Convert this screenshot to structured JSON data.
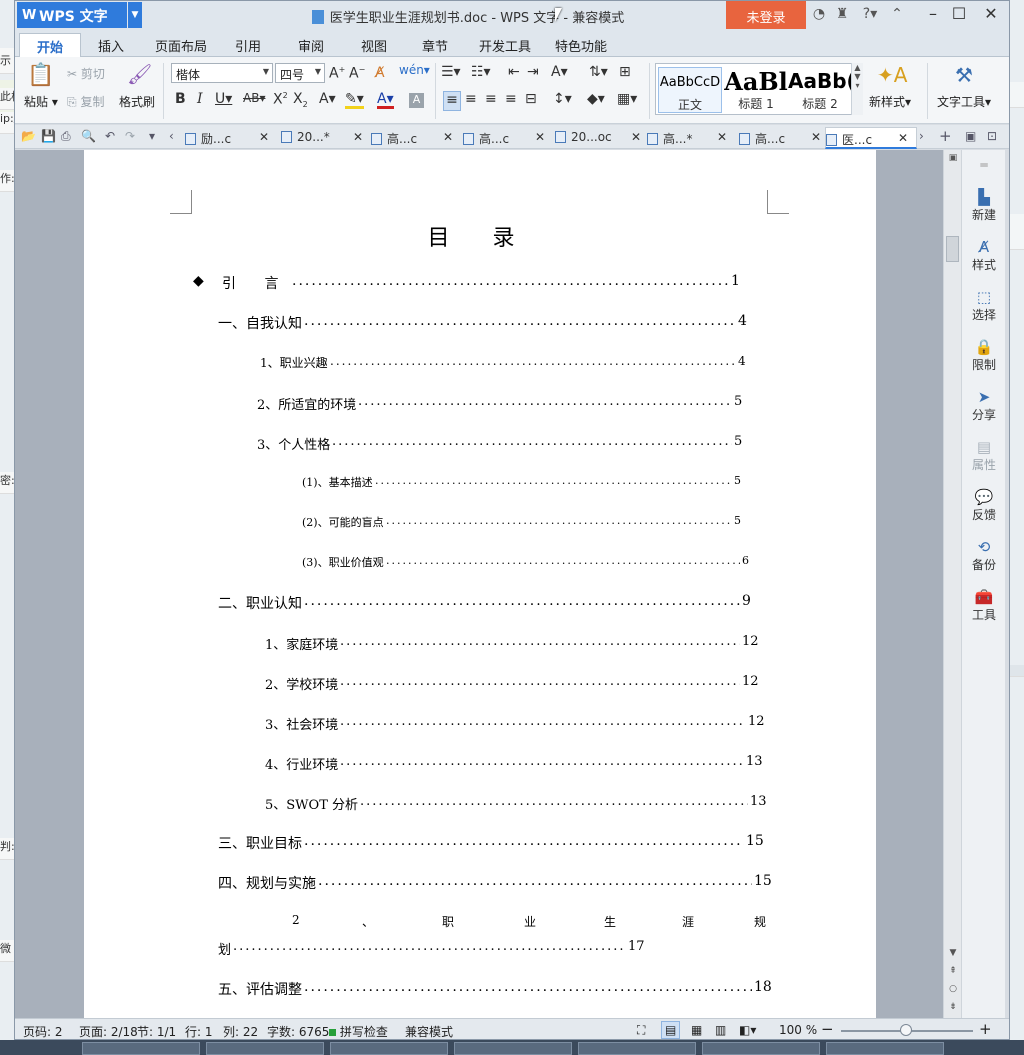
{
  "title": {
    "app": "WPS 文字",
    "doc": "医学生职业生涯规划书.doc - WPS 文字 - 兼容模式",
    "login": "未登录"
  },
  "tabs": [
    "开始",
    "插入",
    "页面布局",
    "引用",
    "审阅",
    "视图",
    "章节",
    "开发工具",
    "特色功能"
  ],
  "ribbon": {
    "paste": "粘贴",
    "cut": "剪切",
    "copy": "复制",
    "format_painter": "格式刷",
    "font": "楷体",
    "size": "四号",
    "new_style": "新样式",
    "text_tools": "文字工具"
  },
  "styles": [
    {
      "preview": "AaBbCcD",
      "label": "正文"
    },
    {
      "preview": "AaBl",
      "label": "标题 1"
    },
    {
      "preview": "AaBb(",
      "label": "标题 2"
    }
  ],
  "doc_tabs": [
    "励...c",
    "20...*",
    "高...c",
    "高...c",
    "20...oc",
    "高...*",
    "高...c",
    "医...c"
  ],
  "desktop_left": [
    "示",
    "此栏",
    "ip:/",
    "作:",
    "密:",
    "判:",
    "",
    "微"
  ],
  "document": {
    "heading": "目 录",
    "entries": [
      {
        "text": "引 言",
        "page": "1",
        "bullet": "◆"
      },
      {
        "text": "一、自我认知",
        "page": "4"
      },
      {
        "text": "1、职业兴趣",
        "page": "4"
      },
      {
        "text": "2、所适宜的环境",
        "page": "5"
      },
      {
        "text": "3、个人性格",
        "page": "5"
      },
      {
        "text": "(1)、基本描述",
        "page": "5"
      },
      {
        "text": "(2)、可能的盲点",
        "page": "5"
      },
      {
        "text": "(3)、职业价值观",
        "page": "6"
      },
      {
        "text": "二、职业认知",
        "page": "9"
      },
      {
        "text": "1、家庭环境",
        "page": "12"
      },
      {
        "text": "2、学校环境",
        "page": "12"
      },
      {
        "text": "3、社会环境",
        "page": "12"
      },
      {
        "text": "4、行业环境",
        "page": "13"
      },
      {
        "text": "5、SWOT 分析",
        "page": "13"
      },
      {
        "text": "三、职业目标",
        "page": "15"
      },
      {
        "text": "四、规划与实施",
        "page": "15"
      },
      {
        "text": "划",
        "page": "17",
        "wrapped": [
          "2",
          "、",
          "职",
          "业",
          "生",
          "涯",
          "规"
        ]
      },
      {
        "text": "五、评估调整",
        "page": "18"
      }
    ]
  },
  "right_panel": [
    "新建",
    "样式",
    "选择",
    "限制",
    "分享",
    "属性",
    "反馈",
    "备份",
    "工具"
  ],
  "status": {
    "page_code": "页码: 2",
    "pages": "页面: 2/18",
    "section": "节: 1/1",
    "row": "行: 1",
    "col": "列: 22",
    "words": "字数: 6765",
    "spell": "拼写检查",
    "compat": "兼容模式",
    "zoom": "100 %"
  }
}
